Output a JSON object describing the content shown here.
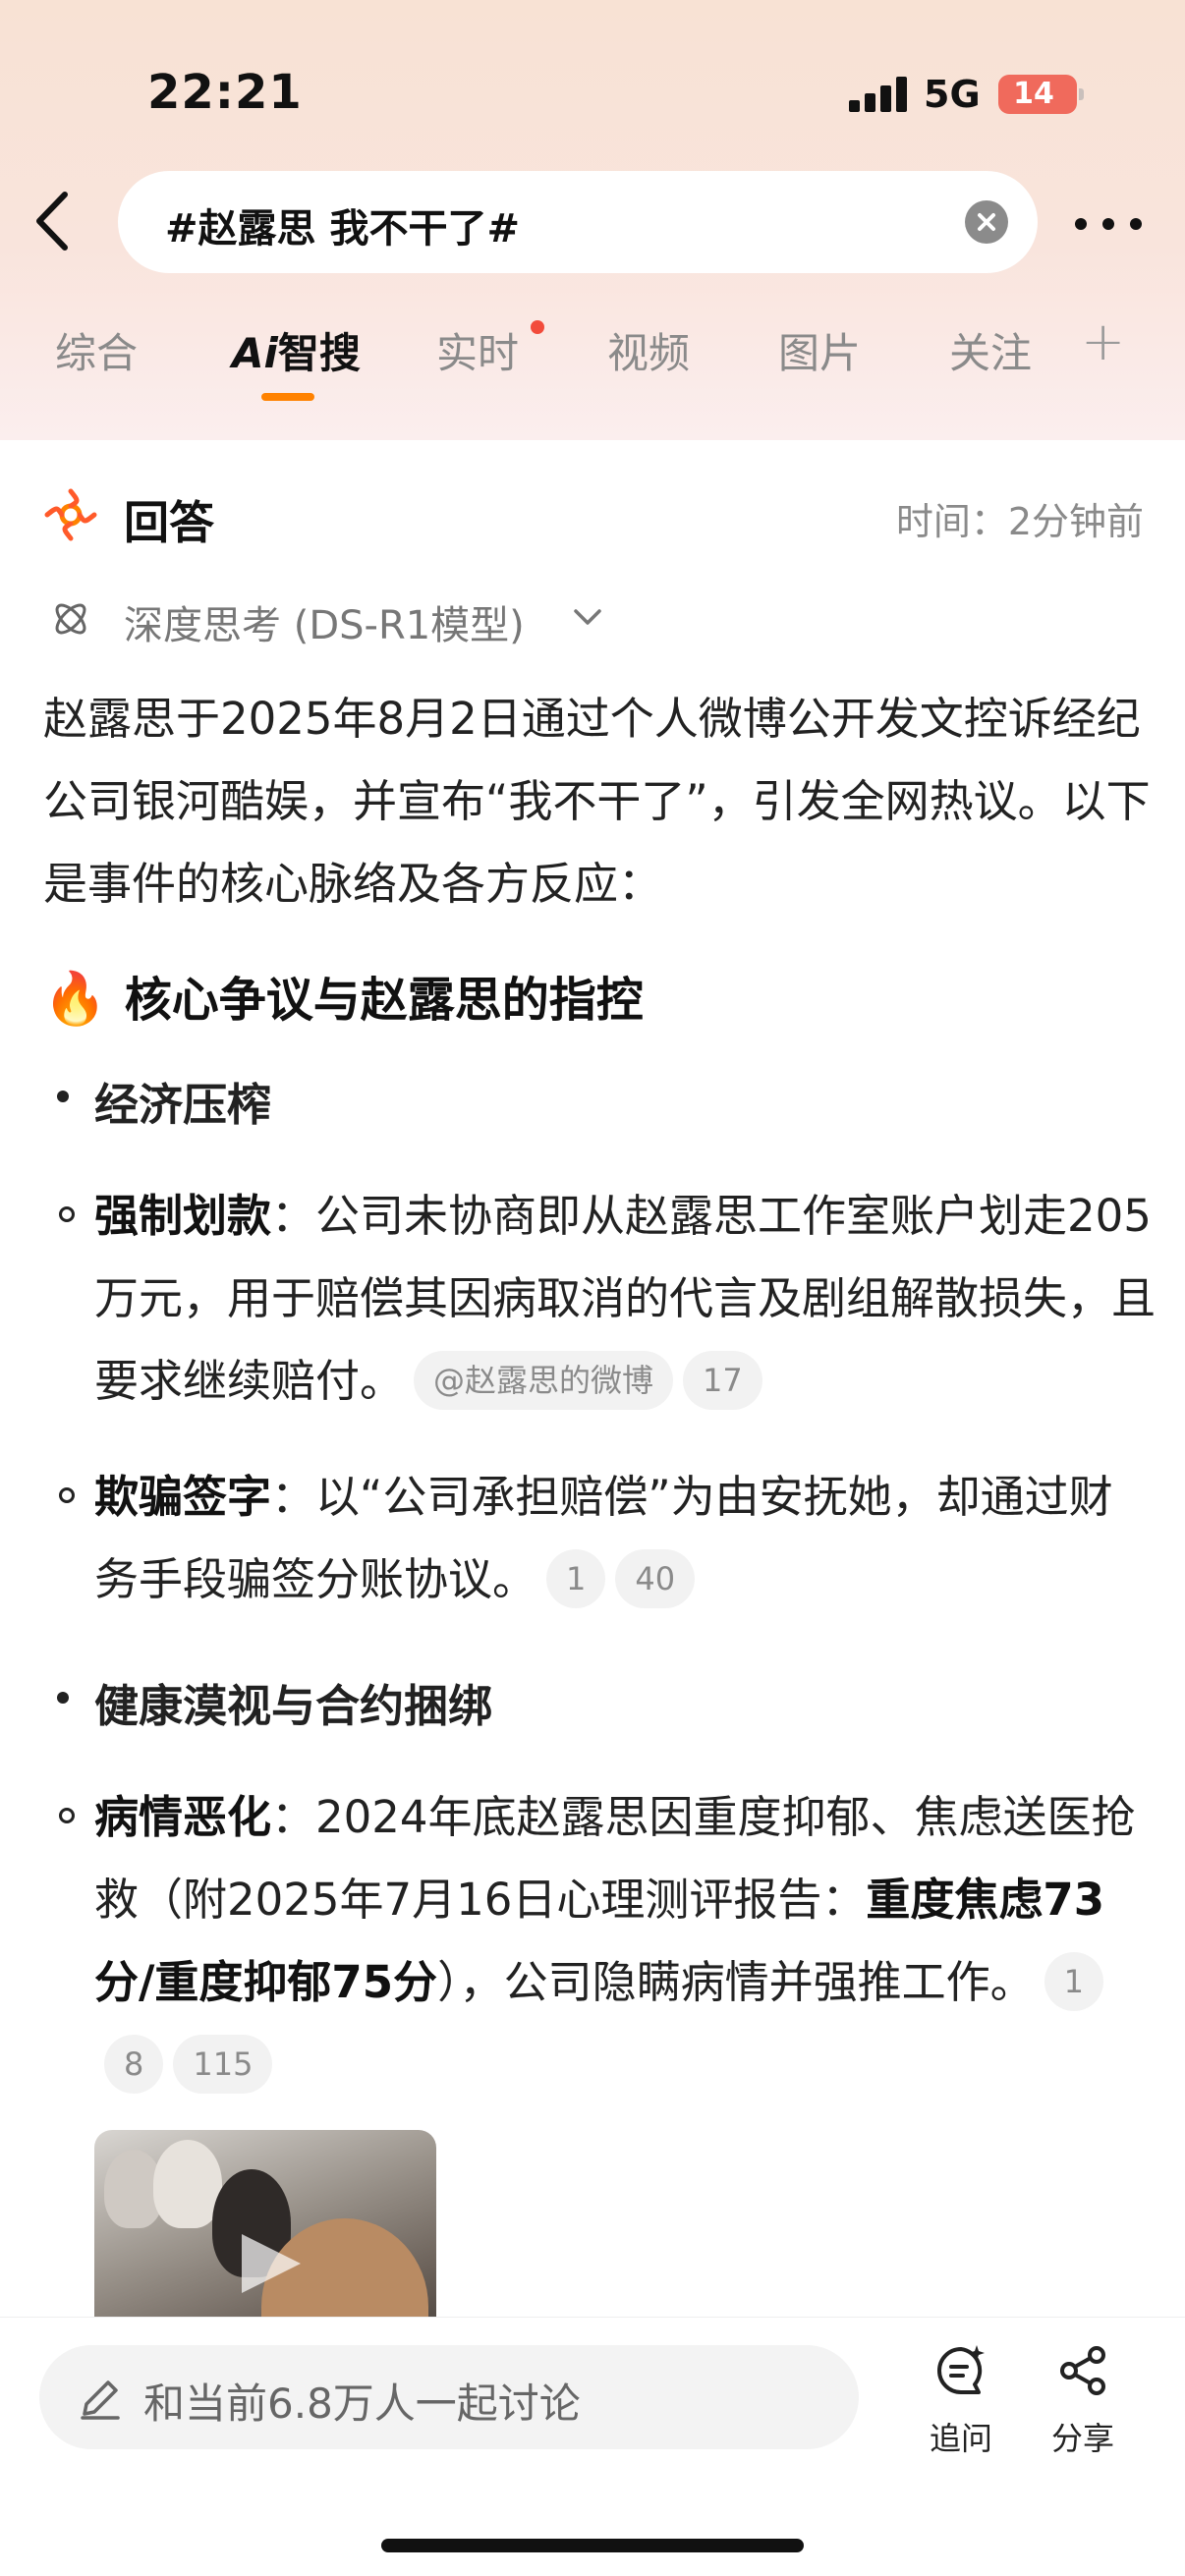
{
  "status_bar": {
    "time": "22:21",
    "network": "5G",
    "battery": "14"
  },
  "header": {
    "search_text": "#赵露思 我不干了#"
  },
  "tabs": [
    {
      "label": "综合"
    },
    {
      "label_ai": "Ai",
      "label": "智搜"
    },
    {
      "label": "实时"
    },
    {
      "label": "视频"
    },
    {
      "label": "图片"
    },
    {
      "label": "关注"
    }
  ],
  "answer": {
    "title": "回答",
    "time": "时间：2分钟前",
    "deep_mode": "深度思考 (DS-R1模型)",
    "intro": "赵露思于2025年8月2日通过个人微博公开发文控诉经纪公司银河酷娱，并宣布“我不干了”，引发全网热议。以下是事件的核心脉络及各方反应：",
    "section_title": "核心争议与赵露思的指控",
    "fire_icon": "🔥",
    "items": [
      {
        "heading": "经济压榨"
      },
      {
        "label": "强制划款",
        "text": "：公司未协商即从赵露思工作室账户划走205万元，用于赔偿其因病取消的代言及剧组解散损失，且要求继续赔付。",
        "chips": [
          "@赵露思的微博",
          "17"
        ]
      },
      {
        "label": "欺骗签字",
        "text": "：以“公司承担赔偿”为由安抚她，却通过财务手段骗签分账协议。",
        "chips": [
          "1",
          "40"
        ]
      },
      {
        "heading": "健康漠视与合约捆绑"
      },
      {
        "label": "病情恶化",
        "text_a": "：2024年底赵露思因重度抑郁、焦虑送医抢救（附2025年7月16日心理测评报告：",
        "bold": "重度焦虑73分/重度抑郁75分",
        "text_b": "），公司隐瞒病情并强推工作。",
        "chips": [
          "1",
          "8",
          "115"
        ]
      }
    ]
  },
  "bottom_bar": {
    "input_placeholder": "和当前6.8万人一起讨论",
    "follow_up": "追问",
    "share": "分享"
  },
  "colors": {
    "accent": "#ff8200",
    "notice_dot": "#f24b3b",
    "battery": "#f06a5c"
  }
}
